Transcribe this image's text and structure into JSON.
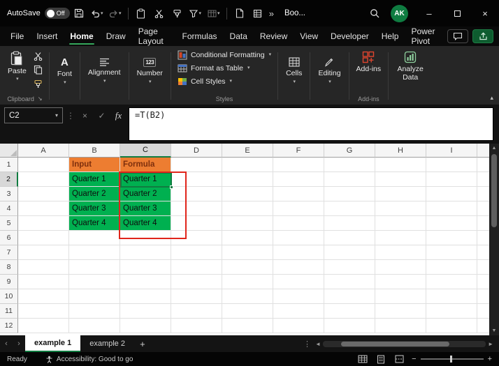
{
  "colors": {
    "accent_green": "#35A85C",
    "selection_green": "#107C41",
    "cell_green_fill": "#00B050",
    "header_orange_fill": "#ED7D31",
    "annotation_red": "#E0251B"
  },
  "titlebar": {
    "autosave_label": "AutoSave",
    "autosave_state": "Off",
    "workbook_title": "Boo...",
    "avatar_initials": "AK"
  },
  "menubar": {
    "tabs": [
      "File",
      "Insert",
      "Home",
      "Draw",
      "Page Layout",
      "Formulas",
      "Data",
      "Review",
      "View",
      "Developer",
      "Help",
      "Power Pivot"
    ],
    "active_tab": "Home"
  },
  "ribbon": {
    "paste_label": "Paste",
    "font_label": "Font",
    "alignment_label": "Alignment",
    "number_label": "Number",
    "conditional_formatting_label": "Conditional Formatting",
    "format_as_table_label": "Format as Table",
    "cell_styles_label": "Cell Styles",
    "cells_label": "Cells",
    "editing_label": "Editing",
    "addins_label": "Add-ins",
    "analyze_data_label": "Analyze Data",
    "group_labels": {
      "clipboard": "Clipboard",
      "styles": "Styles",
      "addins": "Add-ins"
    }
  },
  "formula_bar": {
    "name_box_value": "C2",
    "formula": "=T(B2)"
  },
  "grid": {
    "columns": [
      "A",
      "B",
      "C",
      "D",
      "E",
      "F",
      "G",
      "H",
      "I"
    ],
    "row_count": 12,
    "selected_cell": "C2",
    "selected_column": "C",
    "selected_row": 2,
    "cells": [
      {
        "ref": "B1",
        "text": "Input",
        "style": "orange"
      },
      {
        "ref": "C1",
        "text": "Formula",
        "style": "orange"
      },
      {
        "ref": "B2",
        "text": "Quarter 1",
        "style": "green"
      },
      {
        "ref": "B3",
        "text": "Quarter 2",
        "style": "green"
      },
      {
        "ref": "B4",
        "text": "Quarter 3",
        "style": "green"
      },
      {
        "ref": "B5",
        "text": "Quarter 4",
        "style": "green"
      },
      {
        "ref": "C2",
        "text": "Quarter 1",
        "style": "green"
      },
      {
        "ref": "C3",
        "text": "Quarter 2",
        "style": "green"
      },
      {
        "ref": "C4",
        "text": "Quarter 3",
        "style": "green"
      },
      {
        "ref": "C5",
        "text": "Quarter 4",
        "style": "green"
      }
    ]
  },
  "sheet_tabs": {
    "tabs": [
      {
        "label": "example 1",
        "active": true
      },
      {
        "label": "example 2",
        "active": false
      }
    ],
    "add_button": "+"
  },
  "status_bar": {
    "mode": "Ready",
    "accessibility": "Accessibility: Good to go"
  }
}
